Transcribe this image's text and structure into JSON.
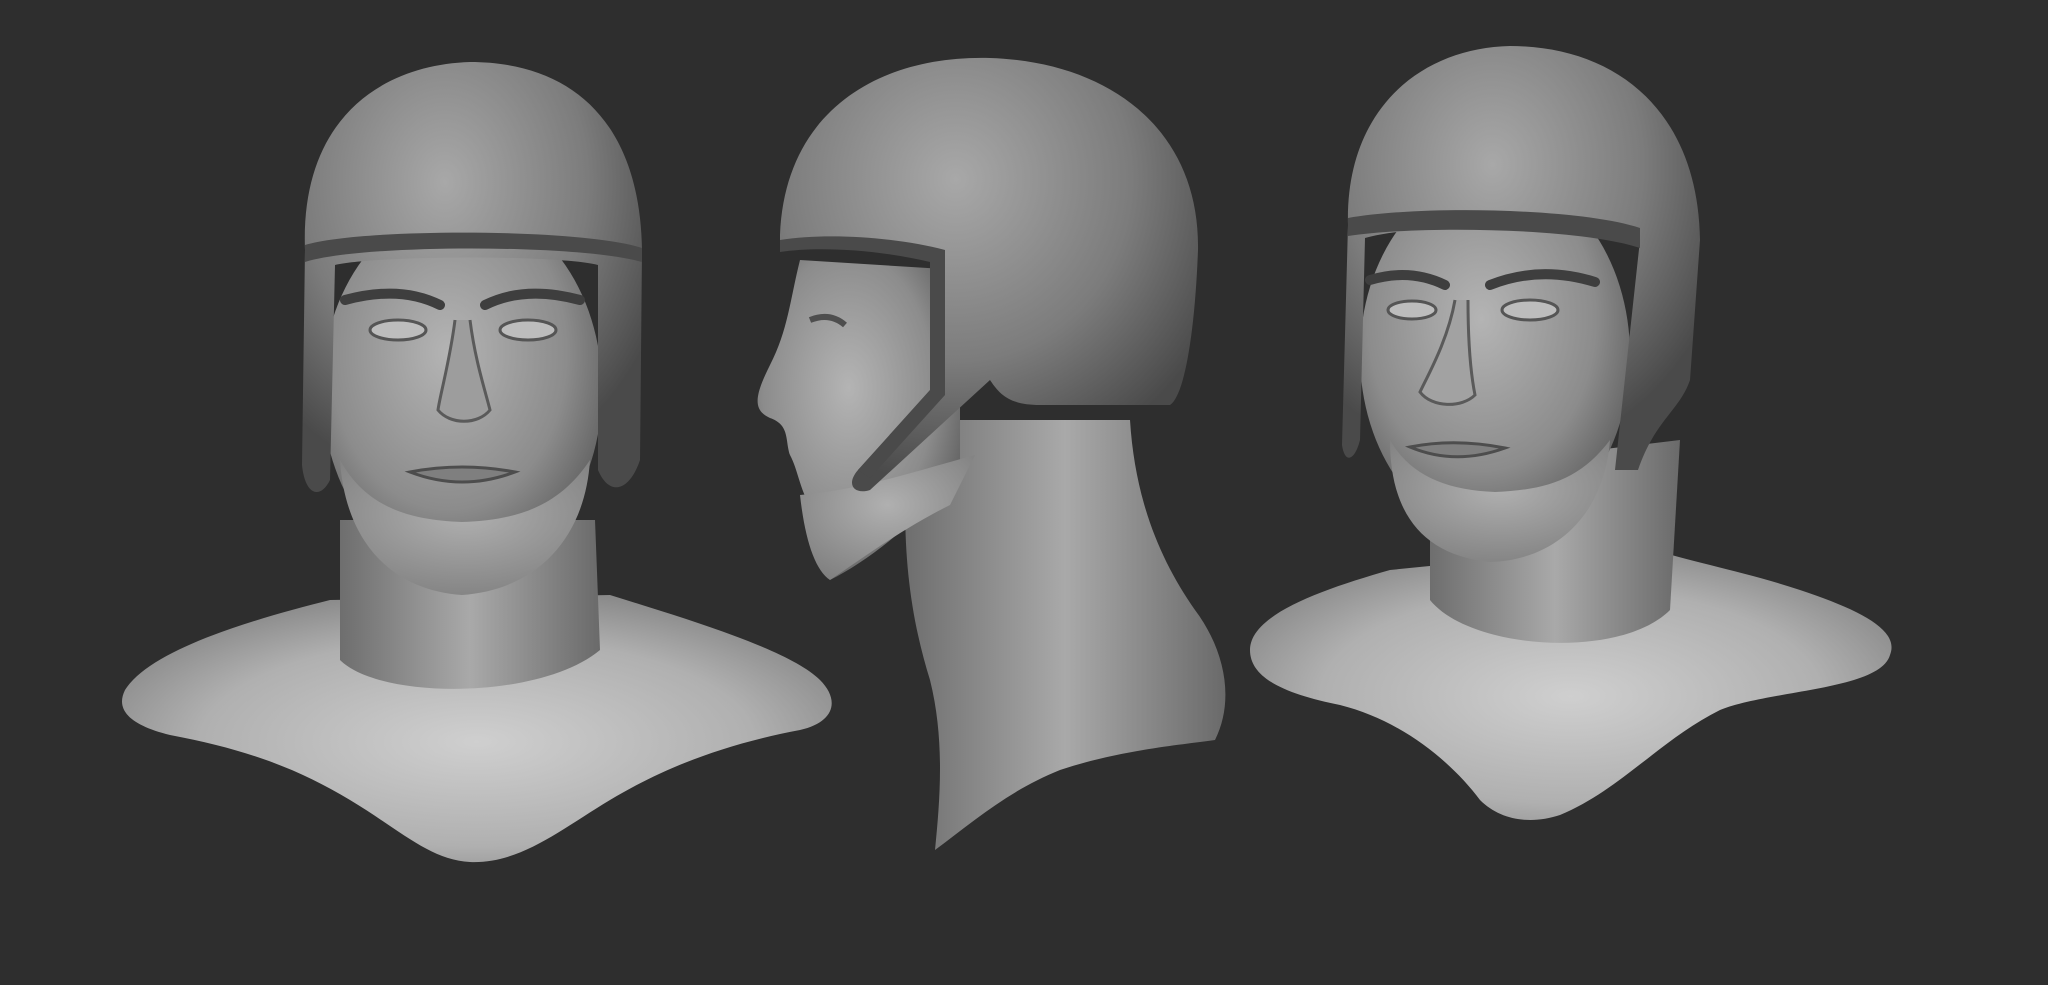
{
  "scene": {
    "background_color": "#2e2e2e",
    "clay_light": "#d2d2d2",
    "clay_mid": "#9a9a9a",
    "clay_dark": "#4a4a4a",
    "views": [
      {
        "name": "front",
        "depicts": "bust-with-helmet"
      },
      {
        "name": "side",
        "depicts": "bust-with-helmet"
      },
      {
        "name": "three-quarter",
        "depicts": "bust-with-helmet"
      }
    ]
  }
}
